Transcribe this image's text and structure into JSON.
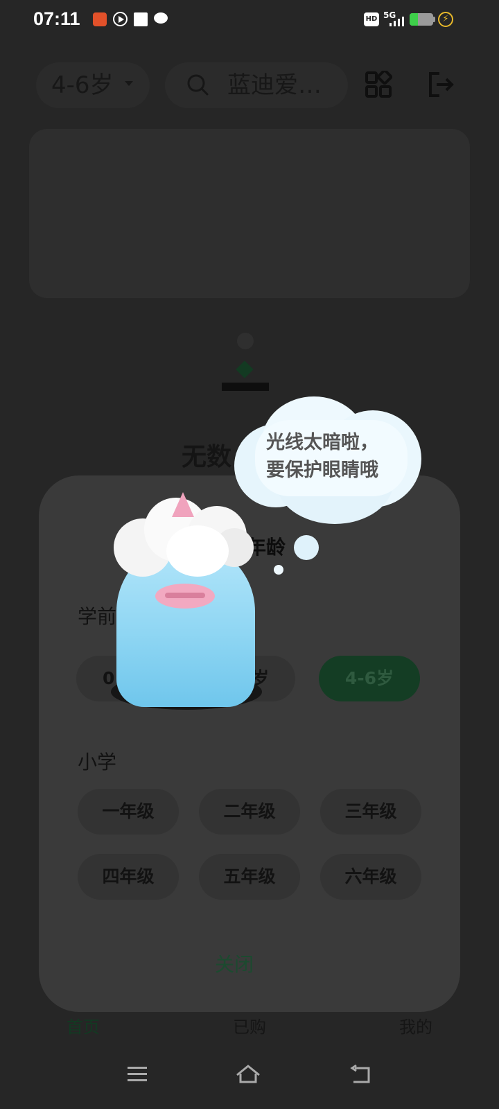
{
  "status_bar": {
    "time": "07:11",
    "network": "5G",
    "hd": "HD"
  },
  "header": {
    "age_selector": "4-6岁",
    "search_text": "蓝迪爱…"
  },
  "empty_state": {
    "title": "无数"
  },
  "modal": {
    "title": "年龄",
    "sections": [
      {
        "label": "学前",
        "chips": [
          {
            "label": "0"
          },
          {
            "label": "岁"
          },
          {
            "label": "4-6岁",
            "active": true
          }
        ]
      },
      {
        "label": "小学",
        "chips": [
          {
            "label": "一年级"
          },
          {
            "label": "二年级"
          },
          {
            "label": "三年级"
          },
          {
            "label": "四年级"
          },
          {
            "label": "五年级"
          },
          {
            "label": "六年级"
          }
        ]
      }
    ],
    "close_label": "关闭"
  },
  "mascot": {
    "bubble_line1": "光线太暗啦，",
    "bubble_line2": "要保护眼睛哦"
  },
  "tab_bar": {
    "home": "首页",
    "purchased": "已购",
    "mine": "我的"
  },
  "colors": {
    "accent_green": "#143d24",
    "mascot_blue": "#8fd6f3"
  }
}
